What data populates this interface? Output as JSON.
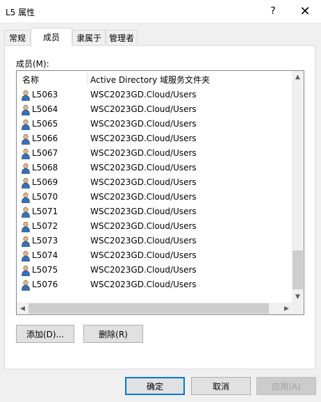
{
  "window": {
    "title": "L5 属性",
    "help_glyph": "?",
    "close_glyph": "✕"
  },
  "tabs": [
    {
      "label": "常规"
    },
    {
      "label": "成员"
    },
    {
      "label": "隶属于"
    },
    {
      "label": "管理者"
    }
  ],
  "active_tab": "成员",
  "members": {
    "label": "成员(M):",
    "columns": [
      "名称",
      "Active Directory 域服务文件夹"
    ],
    "rows": [
      {
        "name": "L5063",
        "folder": "WSC2023GD.Cloud/Users"
      },
      {
        "name": "L5064",
        "folder": "WSC2023GD.Cloud/Users"
      },
      {
        "name": "L5065",
        "folder": "WSC2023GD.Cloud/Users"
      },
      {
        "name": "L5066",
        "folder": "WSC2023GD.Cloud/Users"
      },
      {
        "name": "L5067",
        "folder": "WSC2023GD.Cloud/Users"
      },
      {
        "name": "L5068",
        "folder": "WSC2023GD.Cloud/Users"
      },
      {
        "name": "L5069",
        "folder": "WSC2023GD.Cloud/Users"
      },
      {
        "name": "L5070",
        "folder": "WSC2023GD.Cloud/Users"
      },
      {
        "name": "L5071",
        "folder": "WSC2023GD.Cloud/Users"
      },
      {
        "name": "L5072",
        "folder": "WSC2023GD.Cloud/Users"
      },
      {
        "name": "L5073",
        "folder": "WSC2023GD.Cloud/Users"
      },
      {
        "name": "L5074",
        "folder": "WSC2023GD.Cloud/Users"
      },
      {
        "name": "L5075",
        "folder": "WSC2023GD.Cloud/Users"
      },
      {
        "name": "L5076",
        "folder": "WSC2023GD.Cloud/Users"
      }
    ],
    "row_icon": "user-icon"
  },
  "buttons": {
    "add": "添加(D)...",
    "remove": "删除(R)",
    "ok": "确定",
    "cancel": "取消",
    "apply": "应用(A)"
  },
  "colors": {
    "accent": "#0078d7",
    "disabled_text": "#a0a0a0"
  }
}
